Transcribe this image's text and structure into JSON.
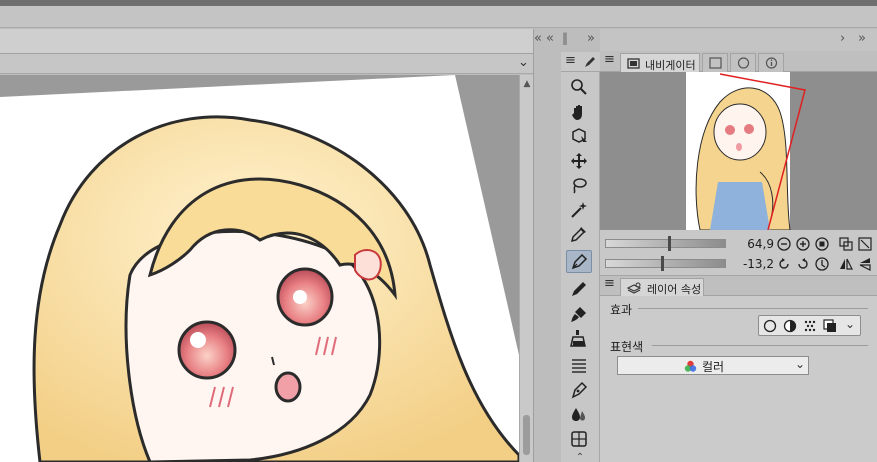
{
  "window": {
    "left_panel_chevrons": "«",
    "left_panel_chevrons2": "«",
    "left_panel_grip": "‖",
    "right_panel_chevrons": "»",
    "right_panel_grip": "‖",
    "far_right_chevrons": "»",
    "canvas_dropdown_glyph": "⌄",
    "scroll_up": "▲",
    "scroll_down": "▼",
    "tool_header_menu": "≡"
  },
  "navigator": {
    "tab_label": "내비게이터",
    "zoom_value": "64,9",
    "rotate_value": "-13,2"
  },
  "layer_property": {
    "tab_label": "레이어 속성",
    "effect_label": "효과",
    "expression_color_label": "표현색",
    "expression_color_value": "컬러"
  },
  "toolbar": {
    "tools": [
      "zoom-tool",
      "hand-tool",
      "object-tool",
      "move-layer-tool",
      "lasso-select-tool",
      "auto-select-tool",
      "eyedropper-tool",
      "pen-tool",
      "pencil-tool",
      "brush-tool",
      "fill-tool",
      "gradient-tool",
      "vector-pen-tool",
      "blend-tool",
      "ruler-tool"
    ],
    "active_tool": "pen-tool"
  },
  "colors": {
    "accent_active": "#a8b6c7",
    "navigator_frame": "#e02020"
  }
}
